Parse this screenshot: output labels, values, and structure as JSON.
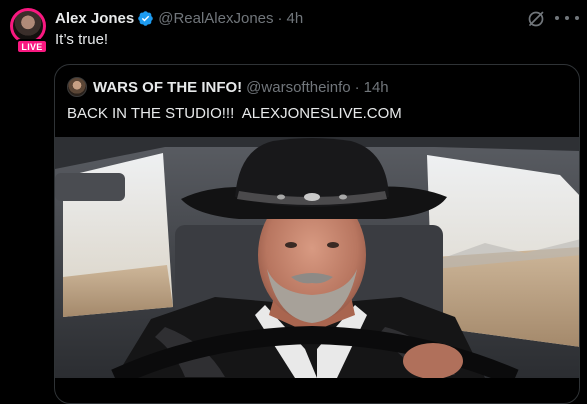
{
  "tweet": {
    "author_name": "Alex Jones",
    "handle": "@RealAlexJones",
    "separator": "·",
    "time": "4h",
    "live_label": "LIVE",
    "text": "It’s true!",
    "icons": {
      "verified": "verified-badge-icon",
      "grok": "grok-icon",
      "more": "more-options-icon"
    },
    "colors": {
      "live_ring": "#f91880",
      "verified": "#1d9bf0",
      "text": "#e7e9ea",
      "muted": "#71767b",
      "border": "#2f3336"
    }
  },
  "quote": {
    "author_name": "WARS OF THE INFO!",
    "handle": "@warsoftheinfo",
    "separator": "·",
    "time": "14h",
    "text": "BACK IN THE STUDIO!!!  ALEXJONESLIVE.COM",
    "image_subject": "man-in-cowboy-hat-driving-car"
  }
}
